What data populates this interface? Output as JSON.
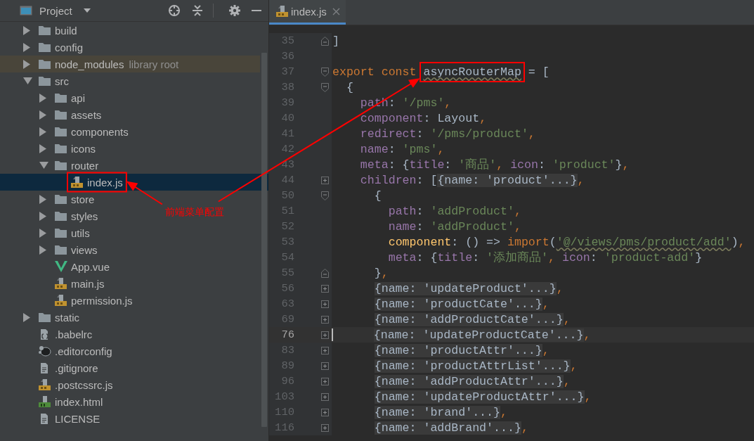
{
  "project_panel": {
    "title": "Project",
    "tree": [
      {
        "name": "build",
        "kind": "folder",
        "expanded": false,
        "selected": false
      },
      {
        "name": "config",
        "kind": "folder",
        "expanded": false,
        "selected": false
      },
      {
        "name": "node_modules",
        "note": "library root",
        "kind": "library_folder",
        "expanded": false,
        "selected": false
      },
      {
        "name": "src",
        "kind": "folder",
        "expanded": true,
        "selected": false,
        "children": [
          {
            "name": "api",
            "kind": "folder",
            "expanded": false,
            "selected": false
          },
          {
            "name": "assets",
            "kind": "folder",
            "expanded": false,
            "selected": false
          },
          {
            "name": "components",
            "kind": "folder",
            "expanded": false,
            "selected": false
          },
          {
            "name": "icons",
            "kind": "folder",
            "expanded": false,
            "selected": false
          },
          {
            "name": "router",
            "kind": "folder",
            "expanded": true,
            "selected": false,
            "children": [
              {
                "name": "index.js",
                "kind": "js",
                "selected": true,
                "boxed": true
              }
            ]
          },
          {
            "name": "store",
            "kind": "folder",
            "expanded": false,
            "selected": false
          },
          {
            "name": "styles",
            "kind": "folder",
            "expanded": false,
            "selected": false
          },
          {
            "name": "utils",
            "kind": "folder",
            "expanded": false,
            "selected": false
          },
          {
            "name": "views",
            "kind": "folder",
            "expanded": false,
            "selected": false
          },
          {
            "name": "App.vue",
            "kind": "vue",
            "selected": false
          },
          {
            "name": "main.js",
            "kind": "js",
            "selected": false
          },
          {
            "name": "permission.js",
            "kind": "js",
            "selected": false
          }
        ]
      },
      {
        "name": "static",
        "kind": "folder",
        "expanded": false,
        "selected": false
      },
      {
        "name": ".babelrc",
        "kind": "json",
        "selected": false
      },
      {
        "name": ".editorconfig",
        "kind": "editorconfig",
        "selected": false
      },
      {
        "name": ".gitignore",
        "kind": "text",
        "selected": false
      },
      {
        "name": ".postcssrc.js",
        "kind": "js",
        "selected": false
      },
      {
        "name": "index.html",
        "kind": "html",
        "selected": false
      },
      {
        "name": "LICENSE",
        "kind": "text",
        "selected": false
      }
    ]
  },
  "editor": {
    "tabs": [
      {
        "label": "index.js",
        "kind": "js",
        "selected": true
      }
    ],
    "lines": [
      {
        "number": "35",
        "kind": "fold_end",
        "current": false,
        "tokens": [
          {
            "text": "]",
            "kind": "plain"
          }
        ]
      },
      {
        "number": "36",
        "kind": "plain",
        "current": false
      },
      {
        "number": "37",
        "kind": "fold_start",
        "current": false,
        "tokens": [
          {
            "text": "export const ",
            "kind": "keyword"
          },
          {
            "text": "asyncRouterMap",
            "kind": "plain",
            "warning": true,
            "boxed": true
          },
          {
            "text": " = [",
            "kind": "plain"
          }
        ]
      },
      {
        "number": "38",
        "kind": "fold_start",
        "current": false,
        "tokens": [
          {
            "text": "  {",
            "kind": "plain"
          }
        ]
      },
      {
        "number": "39",
        "kind": "plain",
        "current": false,
        "tokens": [
          {
            "text": "    path",
            "kind": "property"
          },
          {
            "text": ": ",
            "kind": "plain"
          },
          {
            "text": "'/pms'",
            "kind": "string"
          },
          {
            "text": ",",
            "kind": "keyword"
          }
        ]
      },
      {
        "number": "40",
        "kind": "plain",
        "current": false,
        "tokens": [
          {
            "text": "    component",
            "kind": "property"
          },
          {
            "text": ": Layout",
            "kind": "plain"
          },
          {
            "text": ",",
            "kind": "keyword"
          }
        ]
      },
      {
        "number": "41",
        "kind": "plain",
        "current": false,
        "tokens": [
          {
            "text": "    redirect",
            "kind": "property"
          },
          {
            "text": ": ",
            "kind": "plain"
          },
          {
            "text": "'/pms/product'",
            "kind": "string"
          },
          {
            "text": ",",
            "kind": "keyword"
          }
        ]
      },
      {
        "number": "42",
        "kind": "plain",
        "current": false,
        "tokens": [
          {
            "text": "    name",
            "kind": "property"
          },
          {
            "text": ": ",
            "kind": "plain"
          },
          {
            "text": "'pms'",
            "kind": "string"
          },
          {
            "text": ",",
            "kind": "keyword"
          }
        ]
      },
      {
        "number": "43",
        "kind": "plain",
        "current": false,
        "tokens": [
          {
            "text": "    meta",
            "kind": "property"
          },
          {
            "text": ": {",
            "kind": "plain"
          },
          {
            "text": "title",
            "kind": "property"
          },
          {
            "text": ": ",
            "kind": "plain"
          },
          {
            "text": "'商品'",
            "kind": "string"
          },
          {
            "text": ", ",
            "kind": "keyword"
          },
          {
            "text": "icon",
            "kind": "property"
          },
          {
            "text": ": ",
            "kind": "plain"
          },
          {
            "text": "'product'",
            "kind": "string"
          },
          {
            "text": "}",
            "kind": "plain"
          },
          {
            "text": ",",
            "kind": "keyword"
          }
        ]
      },
      {
        "number": "44",
        "kind": "folded",
        "current": false,
        "tokens": [
          {
            "text": "    children",
            "kind": "property"
          },
          {
            "text": ": [",
            "kind": "plain"
          },
          {
            "text": "{name: 'product'...}",
            "kind": "folded"
          },
          {
            "text": ",",
            "kind": "keyword"
          }
        ]
      },
      {
        "number": "50",
        "kind": "fold_start",
        "current": false,
        "tokens": [
          {
            "text": "      {",
            "kind": "plain"
          }
        ]
      },
      {
        "number": "51",
        "kind": "plain",
        "current": false,
        "tokens": [
          {
            "text": "        path",
            "kind": "property"
          },
          {
            "text": ": ",
            "kind": "plain"
          },
          {
            "text": "'addProduct'",
            "kind": "string"
          },
          {
            "text": ",",
            "kind": "keyword"
          }
        ]
      },
      {
        "number": "52",
        "kind": "plain",
        "current": false,
        "tokens": [
          {
            "text": "        name",
            "kind": "property"
          },
          {
            "text": ": ",
            "kind": "plain"
          },
          {
            "text": "'addProduct'",
            "kind": "string"
          },
          {
            "text": ",",
            "kind": "keyword"
          }
        ]
      },
      {
        "number": "53",
        "kind": "plain",
        "current": false,
        "tokens": [
          {
            "text": "        component",
            "kind": "function"
          },
          {
            "text": ": () => ",
            "kind": "plain"
          },
          {
            "text": "import",
            "kind": "keyword"
          },
          {
            "text": "(",
            "kind": "plain"
          },
          {
            "text": "'@/views/pms/product/add'",
            "kind": "string",
            "warning": true
          },
          {
            "text": ")",
            "kind": "plain"
          },
          {
            "text": ",",
            "kind": "keyword"
          }
        ]
      },
      {
        "number": "54",
        "kind": "plain",
        "current": false,
        "tokens": [
          {
            "text": "        meta",
            "kind": "property"
          },
          {
            "text": ": {",
            "kind": "plain"
          },
          {
            "text": "title",
            "kind": "property"
          },
          {
            "text": ": ",
            "kind": "plain"
          },
          {
            "text": "'添加商品'",
            "kind": "string"
          },
          {
            "text": ", ",
            "kind": "keyword"
          },
          {
            "text": "icon",
            "kind": "property"
          },
          {
            "text": ": ",
            "kind": "plain"
          },
          {
            "text": "'product-add'",
            "kind": "string"
          },
          {
            "text": "}",
            "kind": "plain"
          }
        ]
      },
      {
        "number": "55",
        "kind": "fold_end",
        "current": false,
        "tokens": [
          {
            "text": "      }",
            "kind": "plain"
          },
          {
            "text": ",",
            "kind": "keyword"
          }
        ]
      },
      {
        "number": "56",
        "kind": "folded",
        "current": false,
        "tokens": [
          {
            "text": "      {name: 'updateProduct'...}",
            "kind": "folded"
          },
          {
            "text": ",",
            "kind": "keyword"
          }
        ]
      },
      {
        "number": "63",
        "kind": "folded",
        "current": false,
        "tokens": [
          {
            "text": "      {name: 'productCate'...}",
            "kind": "folded"
          },
          {
            "text": ",",
            "kind": "keyword"
          }
        ]
      },
      {
        "number": "69",
        "kind": "folded",
        "current": false,
        "tokens": [
          {
            "text": "      {name: 'addProductCate'...}",
            "kind": "folded"
          },
          {
            "text": ",",
            "kind": "keyword"
          }
        ]
      },
      {
        "number": "76",
        "kind": "folded",
        "current": true,
        "tokens": [
          {
            "text": "      {name: 'updateProductCate'...}",
            "kind": "folded"
          },
          {
            "text": ",",
            "kind": "keyword"
          }
        ]
      },
      {
        "number": "83",
        "kind": "folded",
        "current": false,
        "tokens": [
          {
            "text": "      {name: 'productAttr'...}",
            "kind": "folded"
          },
          {
            "text": ",",
            "kind": "keyword"
          }
        ]
      },
      {
        "number": "89",
        "kind": "folded",
        "current": false,
        "tokens": [
          {
            "text": "      {name: 'productAttrList'...}",
            "kind": "folded"
          },
          {
            "text": ",",
            "kind": "keyword"
          }
        ]
      },
      {
        "number": "96",
        "kind": "folded",
        "current": false,
        "tokens": [
          {
            "text": "      {name: 'addProductAttr'...}",
            "kind": "folded"
          },
          {
            "text": ",",
            "kind": "keyword"
          }
        ]
      },
      {
        "number": "103",
        "kind": "folded",
        "current": false,
        "tokens": [
          {
            "text": "      {name: 'updateProductAttr'...}",
            "kind": "folded"
          },
          {
            "text": ",",
            "kind": "keyword"
          }
        ]
      },
      {
        "number": "110",
        "kind": "folded",
        "current": false,
        "tokens": [
          {
            "text": "      {name: 'brand'...}",
            "kind": "folded"
          },
          {
            "text": ",",
            "kind": "keyword"
          }
        ]
      },
      {
        "number": "116",
        "kind": "folded",
        "current": false,
        "tokens": [
          {
            "text": "      {name: 'addBrand'...}",
            "kind": "folded"
          },
          {
            "text": ",",
            "kind": "keyword"
          }
        ]
      }
    ]
  },
  "annotation": {
    "text": "前端菜单配置"
  }
}
